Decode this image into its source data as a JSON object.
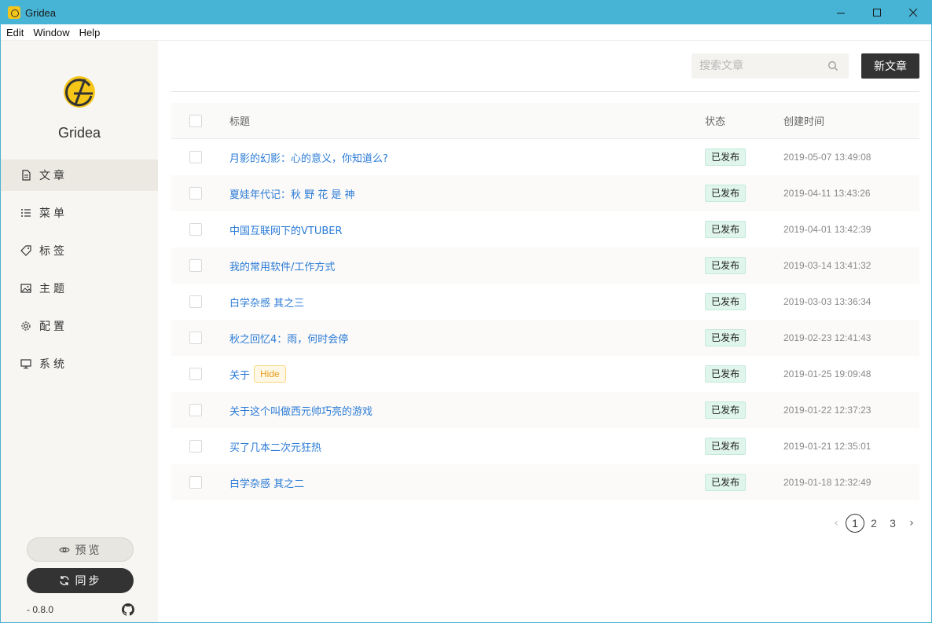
{
  "window": {
    "title": "Gridea",
    "controls": {
      "minimize": "—",
      "maximize": "☐",
      "close": "✕"
    }
  },
  "menu": [
    "Edit",
    "Window",
    "Help"
  ],
  "sidebar": {
    "brand": "Gridea",
    "nav": [
      {
        "label": "文章",
        "icon": "file-icon",
        "active": true
      },
      {
        "label": "菜单",
        "icon": "list-icon",
        "active": false
      },
      {
        "label": "标签",
        "icon": "tag-icon",
        "active": false
      },
      {
        "label": "主题",
        "icon": "image-icon",
        "active": false
      },
      {
        "label": "配置",
        "icon": "gear-icon",
        "active": false
      },
      {
        "label": "系统",
        "icon": "monitor-icon",
        "active": false
      }
    ],
    "preview_label": "预览",
    "sync_label": "同步",
    "version": "- 0.8.0"
  },
  "toolbar": {
    "search_placeholder": "搜索文章",
    "new_post_label": "新文章"
  },
  "table": {
    "headers": {
      "title": "标题",
      "status": "状态",
      "created": "创建时间"
    },
    "rows": [
      {
        "title": "月影的幻影：心的意义，你知道么?",
        "hide": "",
        "status": "已发布",
        "date": "2019-05-07 13:49:08"
      },
      {
        "title": "夏娃年代记：秋 野 花 是 神",
        "hide": "",
        "status": "已发布",
        "date": "2019-04-11 13:43:26"
      },
      {
        "title": "中国互联网下的VTUBER",
        "hide": "",
        "status": "已发布",
        "date": "2019-04-01 13:42:39"
      },
      {
        "title": "我的常用软件/工作方式",
        "hide": "",
        "status": "已发布",
        "date": "2019-03-14 13:41:32"
      },
      {
        "title": "白学杂感 其之三",
        "hide": "",
        "status": "已发布",
        "date": "2019-03-03 13:36:34"
      },
      {
        "title": "秋之回忆4：雨，何时会停",
        "hide": "",
        "status": "已发布",
        "date": "2019-02-23 12:41:43"
      },
      {
        "title": "关于",
        "hide": "Hide",
        "status": "已发布",
        "date": "2019-01-25 19:09:48"
      },
      {
        "title": "关于这个叫做西元帅巧亮的游戏",
        "hide": "",
        "status": "已发布",
        "date": "2019-01-22 12:37:23"
      },
      {
        "title": "买了几本二次元狂热",
        "hide": "",
        "status": "已发布",
        "date": "2019-01-21 12:35:01"
      },
      {
        "title": "白学杂感 其之二",
        "hide": "",
        "status": "已发布",
        "date": "2019-01-18 12:32:49"
      }
    ]
  },
  "pagination": {
    "pages": [
      "1",
      "2",
      "3"
    ],
    "current": "1",
    "prev": "‹",
    "next": "›"
  },
  "colors": {
    "titlebar": "#47b4d5",
    "accent": "#2b7bd6",
    "published_bg": "#e0f5ec",
    "hide_text": "#e59d19",
    "dark_button": "#333333"
  }
}
